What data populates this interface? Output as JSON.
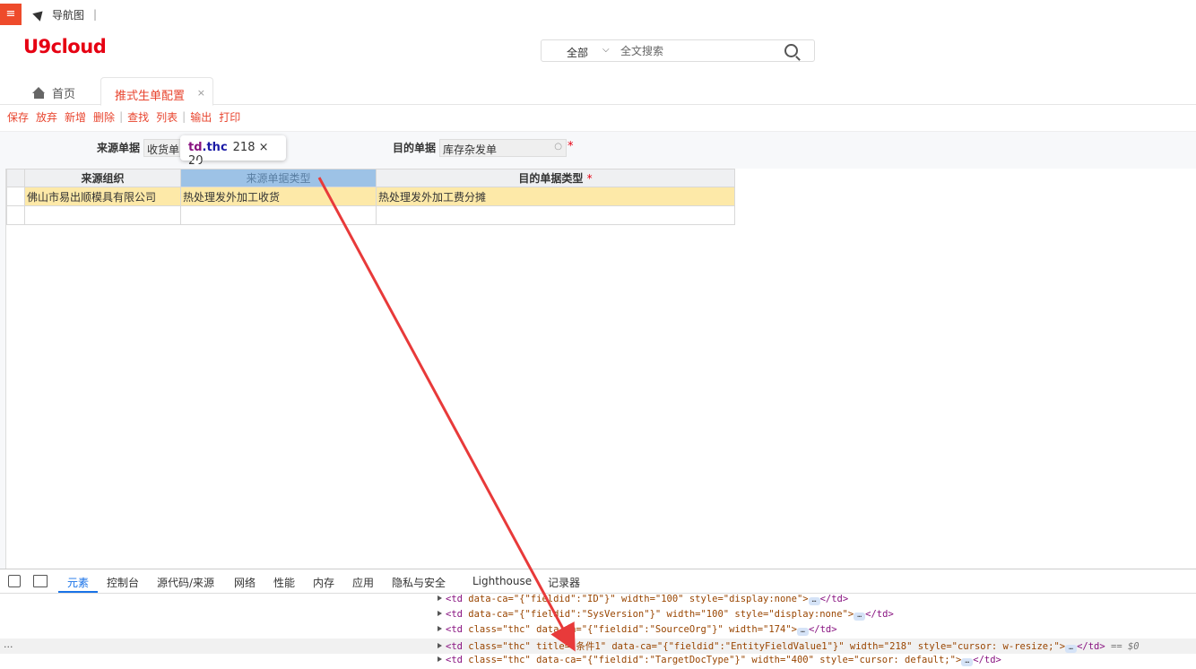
{
  "topbar": {
    "menu_icon": "hamburger-icon",
    "navmap_label": "导航图",
    "sep": "|"
  },
  "logo": {
    "text": "U9cloud"
  },
  "search": {
    "scope": "全部",
    "placeholder": "全文搜索"
  },
  "tabs": {
    "home": "首页",
    "active": "推式生单配置",
    "close": "×"
  },
  "toolbar": {
    "save": "保存",
    "discard": "放弃",
    "add": "新增",
    "delete": "删除",
    "find": "查找",
    "list": "列表",
    "export": "输出",
    "print": "打印"
  },
  "form": {
    "source_label": "来源单据",
    "source_value": "收货单",
    "target_label": "目的单据",
    "target_value": "库存杂发单"
  },
  "grid": {
    "headers": [
      "来源组织",
      "来源单据类型",
      "目的单据类型"
    ],
    "required_mark": "*",
    "rows": [
      [
        "佛山市易出顺模具有限公司",
        "热处理发外加工收货",
        "热处理发外加工费分摊"
      ]
    ]
  },
  "tooltip": {
    "tag": "td",
    "cls": ".thc",
    "dims": "218 × 20"
  },
  "devtools": {
    "tabs": [
      "元素",
      "控制台",
      "源代码/来源",
      "网络",
      "性能",
      "内存",
      "应用",
      "隐私与安全",
      "Lighthouse",
      "记录器"
    ],
    "lines": [
      {
        "tag": "<td",
        "attrs": " data-ca=\"{\"fieldid\":\"ID\"}\" width=\"100\" style=\"display:none\">",
        "close": "</td>"
      },
      {
        "tag": "<td",
        "attrs": " data-ca=\"{\"fieldid\":\"SysVersion\"}\" width=\"100\" style=\"display:none\">",
        "close": "</td>"
      },
      {
        "tag": "<td",
        "attrs": " class=\"thc\" data-ca=\"{\"fieldid\":\"SourceOrg\"}\" width=\"174\">",
        "close": "</td>"
      },
      {
        "tag": "<td",
        "attrs": " class=\"thc\" title=\"条件1\" data-ca=\"{\"fieldid\":\"EntityFieldValue1\"}\" width=\"218\" style=\"cursor: w-resize;\">",
        "close": "</td>",
        "suffix": " == $0"
      },
      {
        "tag": "<td",
        "attrs": " class=\"thc\" data-ca=\"{\"fieldid\":\"TargetDocType\"}\" width=\"400\" style=\"cursor: default;\">",
        "close": "</td>"
      }
    ],
    "dots": "..."
  },
  "colors": {
    "accent": "#e8442e",
    "brand": "#e60012",
    "row_highlight": "#fde9a8",
    "header_selected": "#9dc2e6",
    "devtools_active": "#1a73e8"
  }
}
